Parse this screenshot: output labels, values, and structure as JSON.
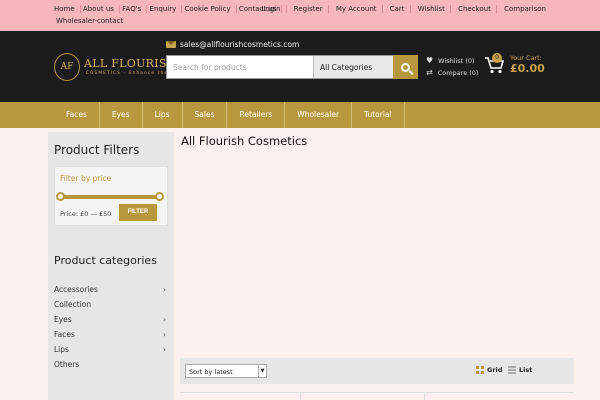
{
  "topbar": {
    "left_links": [
      "Home",
      "About us",
      "FAQ's",
      "Enquiry",
      "Cookie Policy",
      "Contact us"
    ],
    "left_second": "Wholesaler-contact",
    "right_links": [
      "Login",
      "Register",
      "My Account",
      "Cart",
      "Wishlist",
      "Checkout",
      "Comparison"
    ]
  },
  "header": {
    "logo_name": "ALL FLOURISH",
    "logo_sub": "COSMETICS",
    "logo_tagline": "Enhance the Beautiful You",
    "email": "sales@allflourishcosmetics.com",
    "search_placeholder": "Search for products",
    "category": "All Categories",
    "wishlist": "Wishlist (0)",
    "compare": "Compare (0)",
    "cart_label": "Your Cart:",
    "cart_total": "£0.00",
    "cart_count": "0"
  },
  "nav": [
    "Faces",
    "Eyes",
    "Lips",
    "Sales",
    "Retailers",
    "Wholesaler",
    "Tutorial"
  ],
  "sidebar": {
    "title": "Product Filters",
    "price_title": "Filter by price",
    "price_range": "Price: £0 — £50",
    "filter_btn": "FILTER",
    "categories_title": "Product categories",
    "categories": [
      {
        "label": "Accessories",
        "has_children": true
      },
      {
        "label": "Collection",
        "has_children": false
      },
      {
        "label": "Eyes",
        "has_children": true
      },
      {
        "label": "Faces",
        "has_children": true
      },
      {
        "label": "Lips",
        "has_children": true
      },
      {
        "label": "Others",
        "has_children": false
      }
    ]
  },
  "main": {
    "title": "All Flourish Cosmetics",
    "sort": "Sort by latest",
    "grid_label": "Grid",
    "list_label": "List"
  },
  "colors": {
    "gold": "#b8983f",
    "pink": "#f5b7bc",
    "dark": "#1c1c1c"
  }
}
